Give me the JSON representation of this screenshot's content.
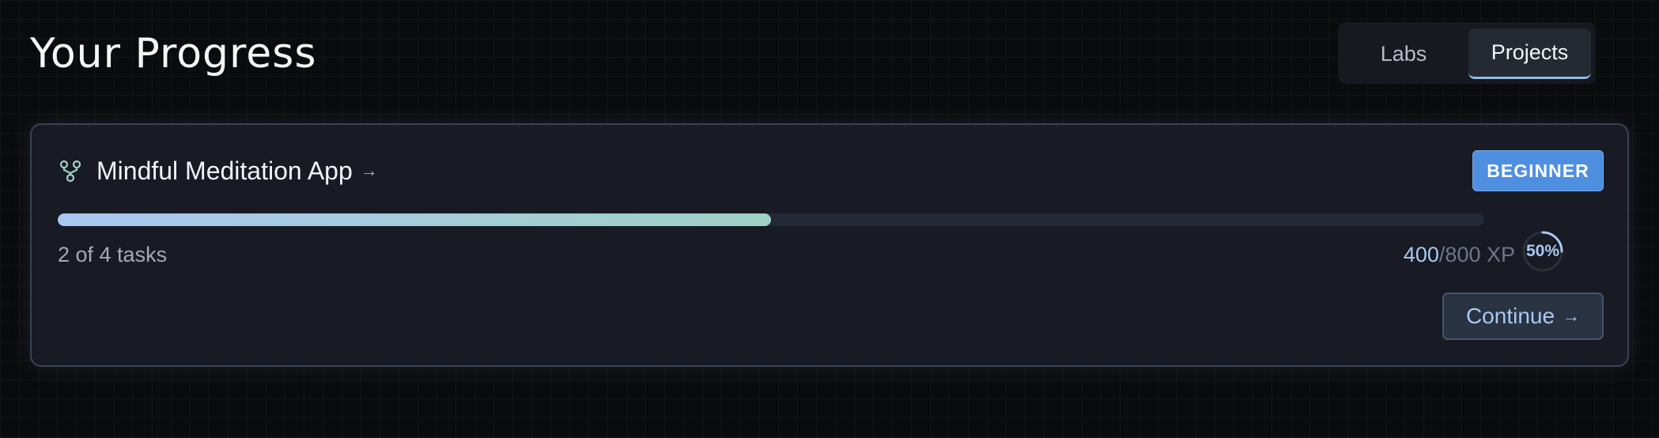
{
  "header": {
    "title": "Your Progress"
  },
  "tabs": [
    {
      "label": "Labs",
      "active": false
    },
    {
      "label": "Projects",
      "active": true
    }
  ],
  "project": {
    "title": "Mindful Meditation App",
    "title_icon": "arrow-right-icon",
    "icon": "project-branch-icon",
    "level": "BEGINNER",
    "tasks_text": "2 of 4 tasks",
    "progress_fraction": 0.5,
    "xp_current": "400",
    "xp_total": "/800 XP",
    "percent": "50%",
    "continue_label": "Continue",
    "continue_icon": "arrow-right-icon"
  },
  "colors": {
    "accent": "#4f8fe0",
    "progress_start": "#a9c8f2",
    "progress_end": "#9fd1c4",
    "icon_teal": "#9fd1c4"
  }
}
